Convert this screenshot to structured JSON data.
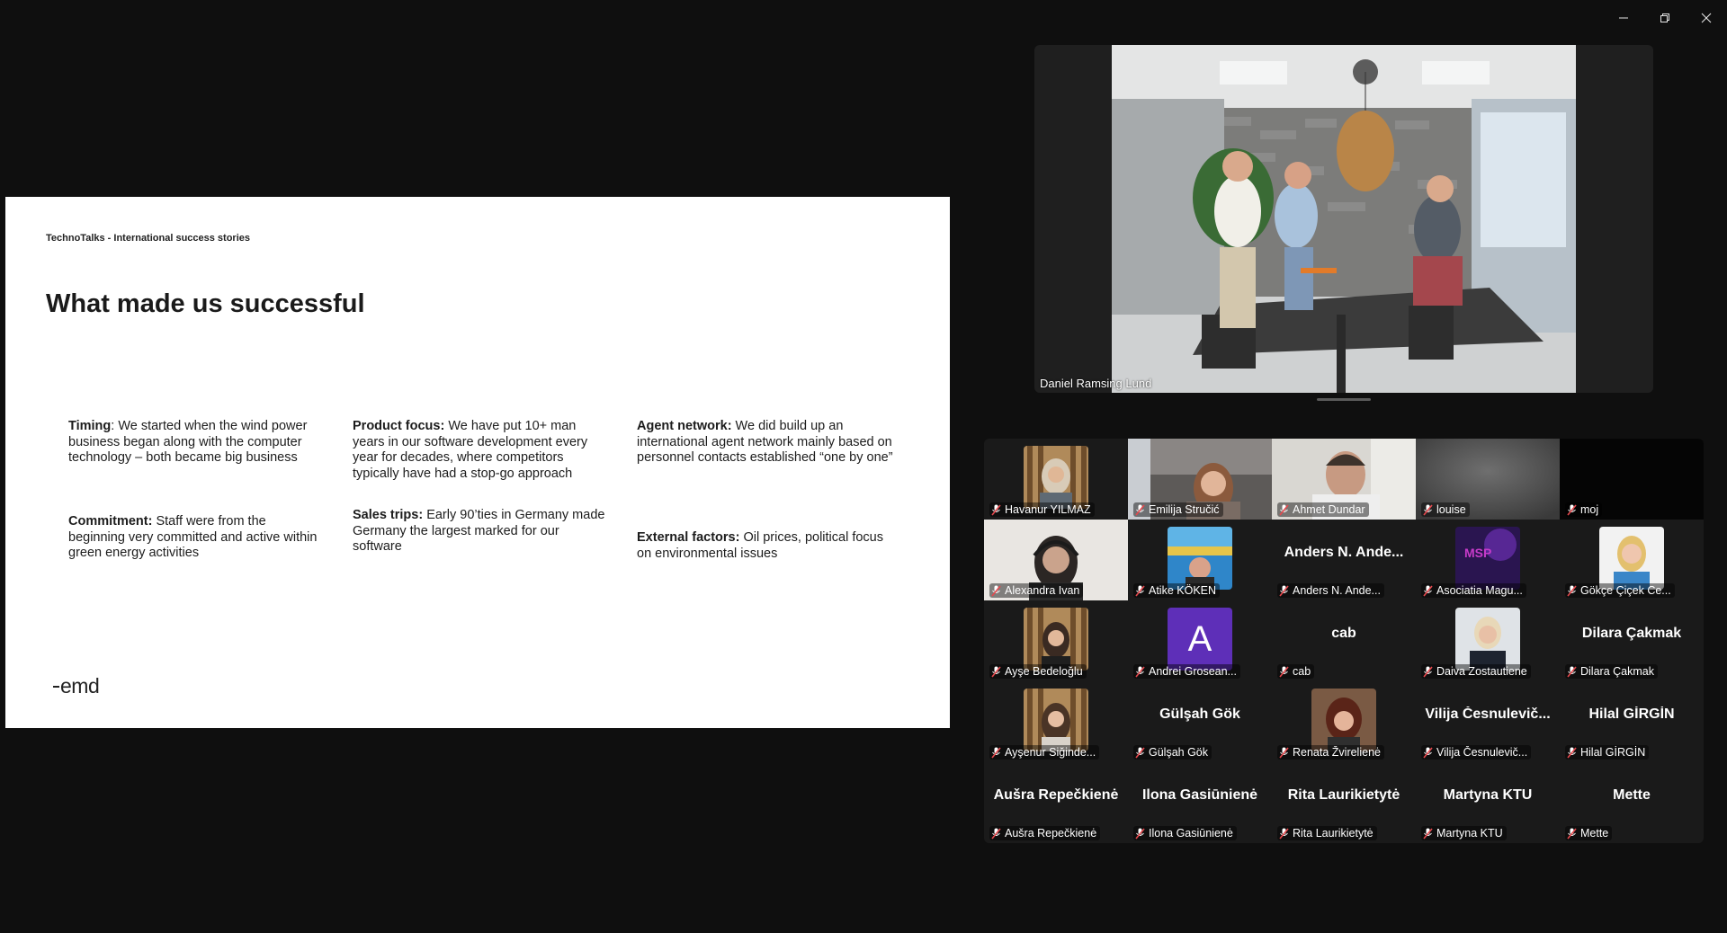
{
  "window": {
    "minimize": "minimize-icon",
    "restore": "restore-icon",
    "close": "close-icon"
  },
  "slide": {
    "kicker": "TechnoTalks - International success stories",
    "title": "What made us successful",
    "blocks": [
      {
        "head": "Timing",
        "text": ": We started when the wind power business began along with the computer technology – both became big business"
      },
      {
        "head": "Product focus:",
        "text": " We have put 10+ man years in our software development every year for decades, where competitors typically have had a stop-go approach"
      },
      {
        "head": "Agent network:",
        "text": " We did build up an international agent network mainly based on personnel contacts established “one by one”"
      },
      {
        "head": "Commitment:",
        "text": " Staff were from the beginning very committed and active within green energy activities"
      },
      {
        "head": "Sales trips:",
        "text": " Early 90’ties in Germany made Germany the largest marked for our software"
      },
      {
        "head": "External factors:",
        "text": " Oil prices, political focus on environmental issues"
      }
    ],
    "logo": "emd"
  },
  "speaker": {
    "name": "Daniel Ramsing Lund"
  },
  "gallery": {
    "tiles": [
      {
        "label": "Havanur YILMAZ",
        "big": ""
      },
      {
        "label": "Emilija Stručić",
        "big": ""
      },
      {
        "label": "Ahmet Dundar",
        "big": ""
      },
      {
        "label": "louise",
        "big": ""
      },
      {
        "label": "moj",
        "big": ""
      },
      {
        "label": "Alexandra Ivan",
        "big": ""
      },
      {
        "label": "Atike KÖKEN",
        "big": ""
      },
      {
        "label": "Anders N. Ande...",
        "big": "Anders N. Ande..."
      },
      {
        "label": "Asociatia Magu...",
        "big": ""
      },
      {
        "label": "Gökçe Çiçek Ce...",
        "big": ""
      },
      {
        "label": "Ayşe Bedeloğlu",
        "big": ""
      },
      {
        "label": "Andrei Grosean...",
        "big": "A"
      },
      {
        "label": "cab",
        "big": "cab"
      },
      {
        "label": "Daiva Zostautiene",
        "big": ""
      },
      {
        "label": "Dilara Çakmak",
        "big": "Dilara Çakmak"
      },
      {
        "label": "Ayşenur Siğinde...",
        "big": ""
      },
      {
        "label": "Gülşah Gök",
        "big": "Gülşah Gök"
      },
      {
        "label": "Renata Žvirelienė",
        "big": ""
      },
      {
        "label": "Vilija Česnulevič...",
        "big": "Vilija  Česnulevič..."
      },
      {
        "label": "Hilal GİRGİN",
        "big": "Hilal GİRGİN"
      },
      {
        "label": "Aušra Repečkienė",
        "big": "Aušra Repečkienė"
      },
      {
        "label": "Ilona Gasiūnienė",
        "big": "Ilona Gasiūnienė"
      },
      {
        "label": "Rita Laurikietytė",
        "big": "Rita Laurikietytė"
      },
      {
        "label": "Martyna KTU",
        "big": "Martyna KTU"
      },
      {
        "label": "Mette",
        "big": "Mette"
      }
    ]
  },
  "colors": {
    "mic_muted": "#e5484d",
    "avatar_purple": "#5e2fb8"
  }
}
